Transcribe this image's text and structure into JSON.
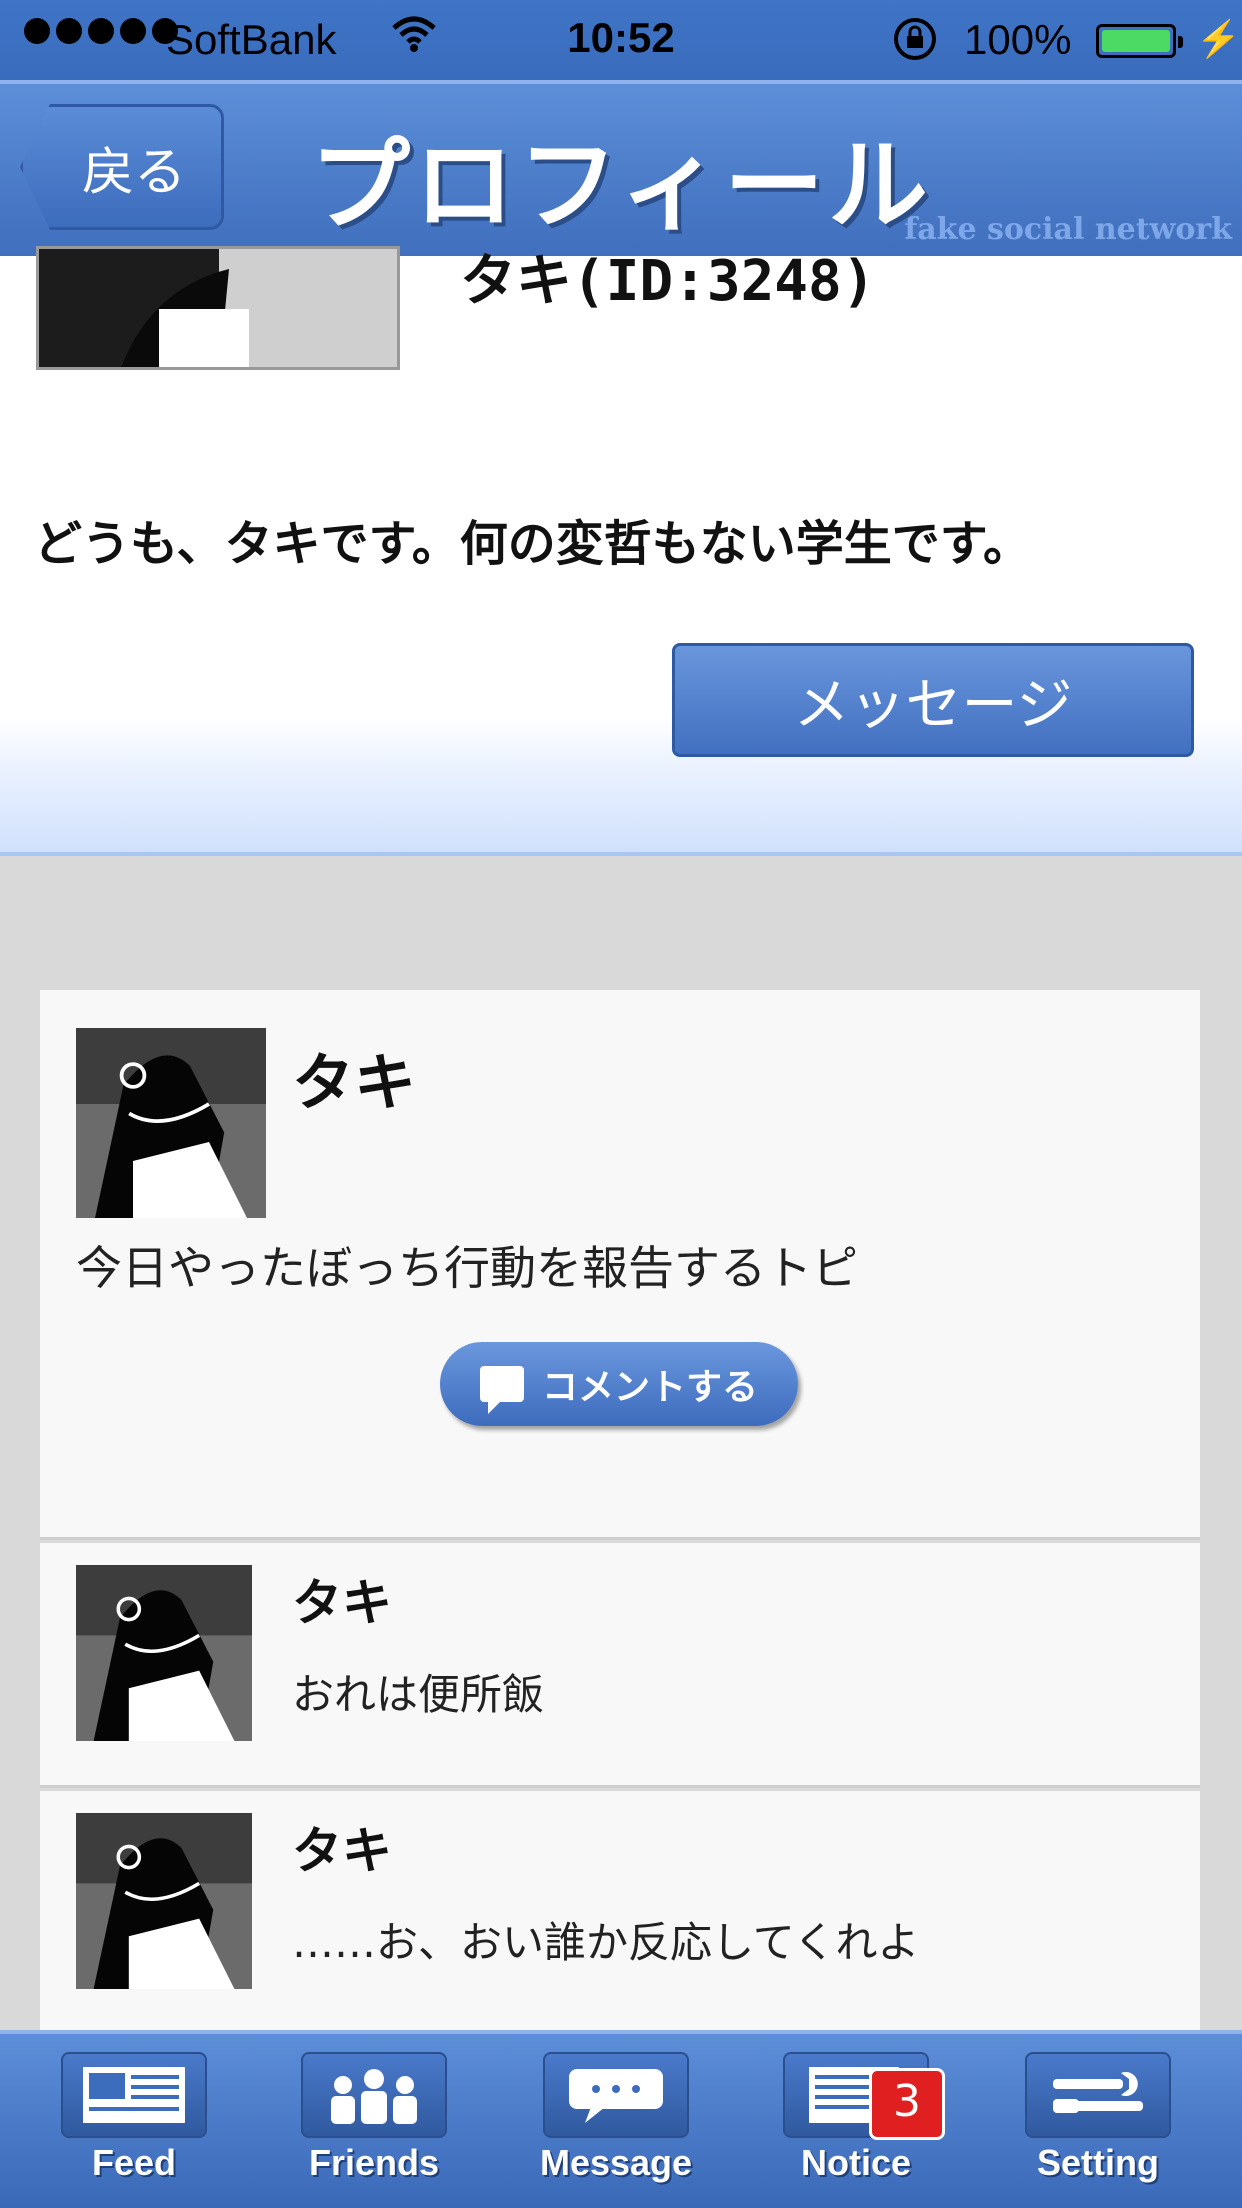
{
  "status_bar": {
    "carrier": "SoftBank",
    "time": "10:52",
    "battery": "100%"
  },
  "nav": {
    "back_label": "戻る",
    "title": "プロフィール",
    "brand": "fake social network"
  },
  "profile": {
    "name": "タキ(ID:3248)",
    "bio": "どうも、タキです。何の変哲もない学生です。",
    "message_button": "メッセージ"
  },
  "feed": {
    "topic": {
      "author": "タキ",
      "text": "今日やったぼっち行動を報告するトピ",
      "comment_button": "コメントする"
    },
    "replies": [
      {
        "author": "タキ",
        "text": "おれは便所飯"
      },
      {
        "author": "タキ",
        "text": "……お、おい誰か反応してくれよ"
      }
    ]
  },
  "tabs": [
    {
      "label": "Feed",
      "icon": "feed-icon"
    },
    {
      "label": "Friends",
      "icon": "friends-icon"
    },
    {
      "label": "Message",
      "icon": "message-icon"
    },
    {
      "label": "Notice",
      "icon": "notice-icon",
      "badge": "3"
    },
    {
      "label": "Setting",
      "icon": "tools-icon"
    }
  ],
  "colors": {
    "accent": "#4a7bcf",
    "badge": "#e02020",
    "battery": "#4cd964"
  }
}
